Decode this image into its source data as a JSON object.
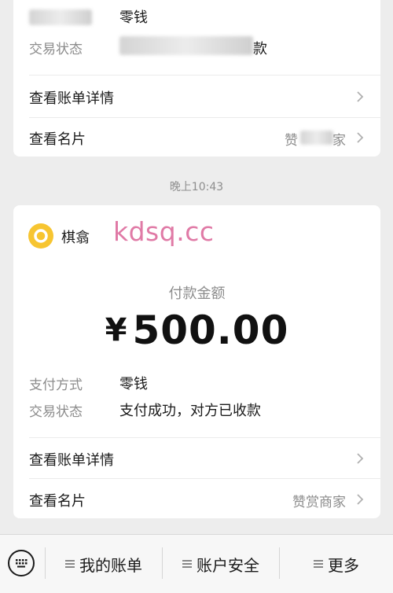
{
  "prev_card": {
    "payment_method_value": "零钱",
    "status_label": "交易状态",
    "status_value_tail": "款",
    "bill_details_label": "查看账单详情",
    "card_label": "查看名片",
    "card_value_head": "赞",
    "card_value_tail": "家"
  },
  "timestamp": "晚上10:43",
  "payment": {
    "merchant_name": "棋翕",
    "watermark": "kdsq.cc",
    "amount_label": "付款金额",
    "currency": "¥",
    "amount": "500.00",
    "payment_method_label": "支付方式",
    "payment_method_value": "零钱",
    "status_label": "交易状态",
    "status_value": "支付成功，对方已收款",
    "bill_details_label": "查看账单详情",
    "card_label": "查看名片",
    "card_value": "赞赏商家"
  },
  "tabbar": {
    "tabs": [
      {
        "label": "我的账单"
      },
      {
        "label": "账户安全"
      },
      {
        "label": "更多"
      }
    ]
  },
  "colors": {
    "background": "#ededed",
    "card": "#ffffff",
    "merchant_icon": "#f7c531",
    "watermark": "#e07aa6"
  },
  "icons": {
    "merchant": "ring-logo-icon",
    "row_arrow": "chevron-right-icon",
    "keyboard": "keyboard-icon",
    "tab_menu": "menu-lines-icon"
  }
}
